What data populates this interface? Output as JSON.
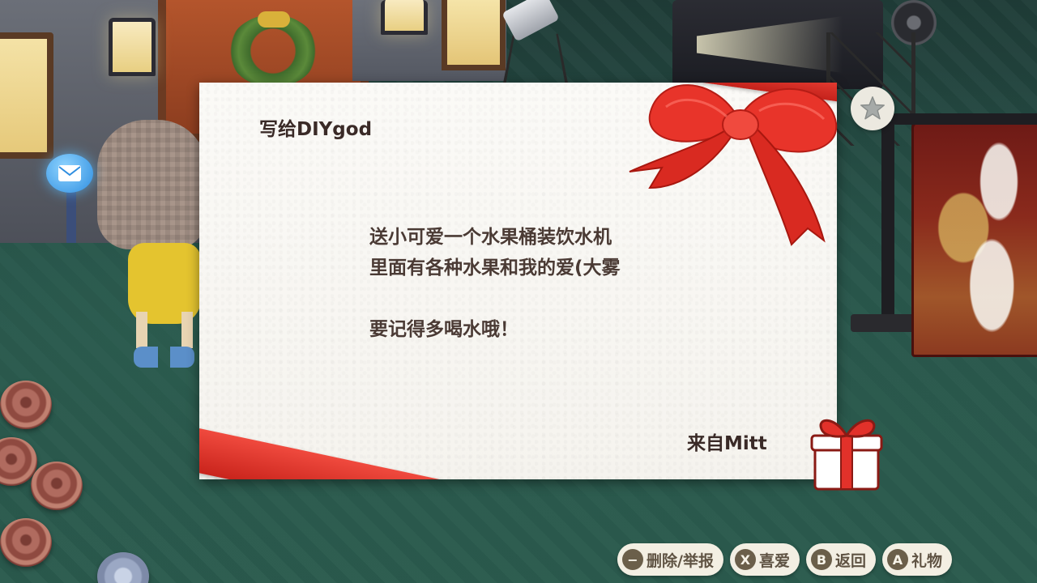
{
  "letter": {
    "to": "写给DIYgod",
    "body_lines": [
      "送小可爱一个水果桶装饮水机",
      "里面有各种水果和我的爱(大雾",
      "",
      "要记得多喝水哦！"
    ],
    "from": "来自Mitt"
  },
  "buttons": [
    {
      "key": "−",
      "label": "删除/举报"
    },
    {
      "key": "X",
      "label": "喜爱"
    },
    {
      "key": "B",
      "label": "返回"
    },
    {
      "key": "A",
      "label": "礼物"
    }
  ],
  "icons": {
    "star": "star-icon",
    "gift": "gift-box-icon",
    "mail": "envelope-icon"
  },
  "colors": {
    "ribbon": "#e63b30",
    "card": "#f7f5f0",
    "button_bg": "#f3efe3",
    "button_key": "#6b5f4a",
    "text": "#3f2f2a"
  }
}
